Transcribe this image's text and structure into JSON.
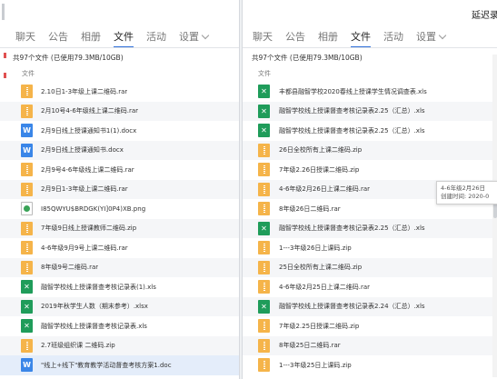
{
  "left": {
    "tabs": [
      {
        "label": "聊天"
      },
      {
        "label": "公告"
      },
      {
        "label": "相册"
      },
      {
        "label": "文件"
      },
      {
        "label": "活动"
      },
      {
        "label": "设置"
      }
    ],
    "summary": "共97个文件 (已使用79.3MB/10GB)",
    "column_header": "文件",
    "files": [
      {
        "name": "2.10日1-3年级上课二维码.rar",
        "type": "rar"
      },
      {
        "name": "2月10号4-6年级线上课二维码.rar",
        "type": "rar"
      },
      {
        "name": "2月9日线上授课通知书1(1).docx",
        "type": "doc"
      },
      {
        "name": "2月9日线上授课通知书.docx",
        "type": "doc"
      },
      {
        "name": "2月9号4-6年级线上课二维码.rar",
        "type": "rar"
      },
      {
        "name": "2月9日1-3年级上课二维码.rar",
        "type": "rar"
      },
      {
        "name": "I85QWYU$BRDGK(YI]0P4)XB.png",
        "type": "png"
      },
      {
        "name": "7年级9日线上授课教师二维码.zip",
        "type": "zip"
      },
      {
        "name": "4-6年级9月9号上课二维码.rar",
        "type": "rar"
      },
      {
        "name": "8年级9号二维码.rar",
        "type": "rar"
      },
      {
        "name": "融智学校线上授课督查考核记录表(1).xls",
        "type": "xls"
      },
      {
        "name": "2019年秋学生人数（期末参考）.xlsx",
        "type": "xls"
      },
      {
        "name": "融智学校线上授课督查考核记录表.xls",
        "type": "xls"
      },
      {
        "name": "2.7班级组织课 二维码.zip",
        "type": "zip"
      },
      {
        "name": "\"线上+线下\"教育教学活动督查考核方案1.doc",
        "type": "doc"
      }
    ]
  },
  "right": {
    "title": "延迟录",
    "tabs": [
      {
        "label": "聊天"
      },
      {
        "label": "公告"
      },
      {
        "label": "相册"
      },
      {
        "label": "文件"
      },
      {
        "label": "活动"
      },
      {
        "label": "设置"
      }
    ],
    "summary": "共97个文件 (已使用79.3MB/10GB)",
    "column_header": "文件",
    "files": [
      {
        "name": "丰都县融智学校2020春线上授课学生情况调查表.xls",
        "type": "xls"
      },
      {
        "name": "融智学校线上授课督查考核记录表2.25（汇总）.xls",
        "type": "xls"
      },
      {
        "name": "融智学校线上授课督查考核记录表2.25（汇总）.xls",
        "type": "xls"
      },
      {
        "name": "26日全校所有上课二维码.zip",
        "type": "zip"
      },
      {
        "name": "7年级2.26日授课二维码.zip",
        "type": "zip"
      },
      {
        "name": "4-6年级2月26日上课二维码.rar",
        "type": "rar"
      },
      {
        "name": "8年级26日二维码.rar",
        "type": "rar"
      },
      {
        "name": "融智学校线上授课督查考核记录表2.25（汇总）.xls",
        "type": "xls"
      },
      {
        "name": "1---3年级26日上课码.zip",
        "type": "zip"
      },
      {
        "name": "25日全校所有上课二维码.zip",
        "type": "zip"
      },
      {
        "name": "4-6年级2月25日上课二维码.rar",
        "type": "rar"
      },
      {
        "name": "融智学校线上授课督查考核记录表2.24（汇总）.xls",
        "type": "xls"
      },
      {
        "name": "7年级2.25日授课二维码.zip",
        "type": "zip"
      },
      {
        "name": "8年级25日二维码.rar",
        "type": "rar"
      },
      {
        "name": "1---3年级25日上课码.zip",
        "type": "zip"
      }
    ],
    "tooltip": {
      "line1": "4-6年级2月26日",
      "line2": "创建时间: 2020-0"
    }
  },
  "colors": {
    "accent": "#2e6fd9",
    "archive": "#f5b44a",
    "excel": "#1f9c5a",
    "word": "#3a86e8"
  },
  "icons": {
    "archive": "archive-file-icon",
    "excel": "excel-file-icon",
    "word": "word-file-icon",
    "image": "image-file-icon"
  }
}
